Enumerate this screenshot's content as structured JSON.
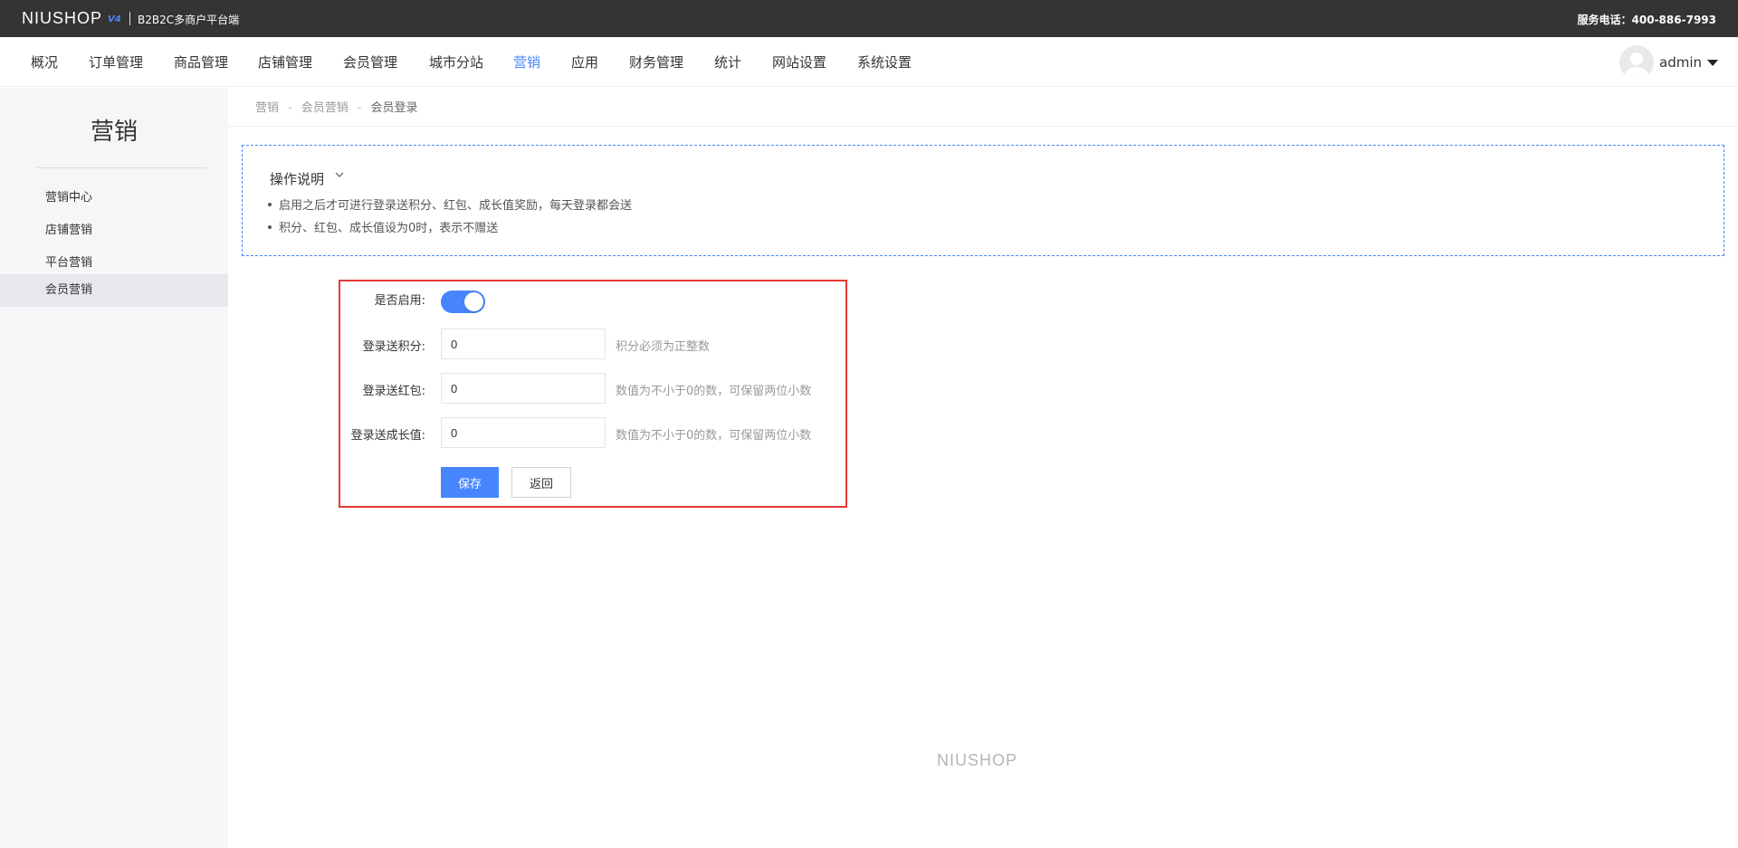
{
  "topbar": {
    "logo": "NIUSHOP",
    "logo_version": "V4",
    "subtitle": "B2B2C多商户平台端",
    "service_phone": "服务电话：400-886-7993"
  },
  "nav": {
    "items": [
      "概况",
      "订单管理",
      "商品管理",
      "店铺管理",
      "会员管理",
      "城市分站",
      "营销",
      "应用",
      "财务管理",
      "统计",
      "网站设置",
      "系统设置"
    ],
    "active": "营销",
    "user_name": "admin"
  },
  "sidebar": {
    "title": "营销",
    "items": [
      "营销中心",
      "店铺营销",
      "平台营销",
      "会员营销"
    ],
    "active": "会员营销"
  },
  "breadcrumb": {
    "items": [
      "营销",
      "会员营销",
      "会员登录"
    ],
    "separator": "-"
  },
  "notice": {
    "title": "操作说明",
    "items": [
      "启用之后才可进行登录送积分、红包、成长值奖励，每天登录都会送",
      "积分、红包、成长值设为0时，表示不赠送"
    ]
  },
  "form": {
    "enable_label": "是否启用:",
    "enabled": true,
    "points_label": "登录送积分:",
    "points_value": "0",
    "points_hint": "积分必须为正整数",
    "redpacket_label": "登录送红包:",
    "redpacket_value": "0",
    "redpacket_hint": "数值为不小于0的数，可保留两位小数",
    "growth_label": "登录送成长值:",
    "growth_value": "0",
    "growth_hint": "数值为不小于0的数，可保留两位小数",
    "save_label": "保存",
    "back_label": "返回"
  },
  "footer": {
    "logo": "NIUSHOP"
  },
  "colors": {
    "accent": "#4685fd",
    "topbar_bg": "#343434",
    "highlight_border": "#e53935"
  }
}
